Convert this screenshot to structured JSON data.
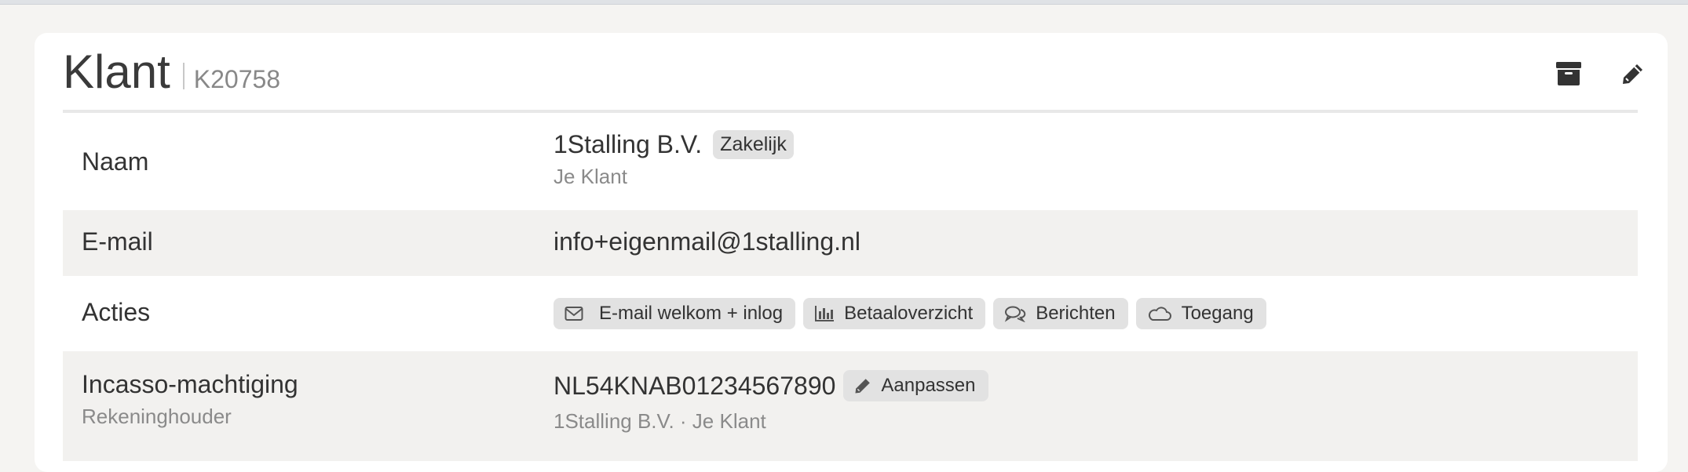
{
  "page": {
    "title": "Klant",
    "code": "K20758",
    "actions": {
      "archive_icon": "archive-icon",
      "edit_icon": "pencil-icon"
    }
  },
  "rows": {
    "naam": {
      "label": "Naam",
      "value": "1Stalling B.V.",
      "badge": "Zakelijk",
      "sub": "Je Klant"
    },
    "email": {
      "label": "E-mail",
      "value": "info+eigenmail@1stalling.nl"
    },
    "acties": {
      "label": "Acties",
      "buttons": [
        {
          "label": "E-mail welkom + inlog",
          "icon": "envelope-icon"
        },
        {
          "label": "Betaaloverzicht",
          "icon": "bar-chart-icon"
        },
        {
          "label": "Berichten",
          "icon": "chat-icon"
        },
        {
          "label": "Toegang",
          "icon": "cloud-icon"
        }
      ]
    },
    "incasso": {
      "label": "Incasso-machtiging",
      "sublabel": "Rekeninghouder",
      "value": "NL54KNAB01234567890",
      "button": "Aanpassen",
      "button_icon": "pencil-icon",
      "sub": "1Stalling B.V. · Je Klant"
    }
  },
  "colors": {
    "background": "#f5f4f2",
    "card": "#ffffff",
    "row_alt": "#f2f1ef",
    "badge": "#e2e2e2",
    "text": "#333333",
    "muted": "#8a8a8a"
  }
}
